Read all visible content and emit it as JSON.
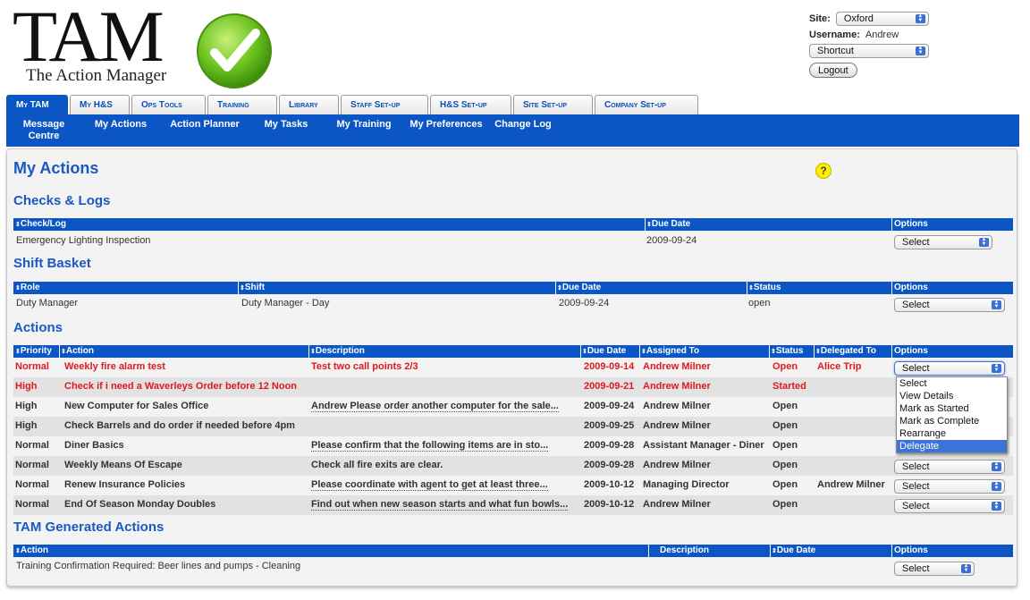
{
  "logo": {
    "title": "TAM",
    "subtitle": "The Action Manager"
  },
  "top_right": {
    "site_label": "Site:",
    "site_value": "Oxford",
    "username_label": "Username:",
    "username_value": "Andrew",
    "shortcut_value": "Shortcut",
    "logout_label": "Logout"
  },
  "tabs": [
    "My TAM",
    "My H&S",
    "Ops Tools",
    "Training",
    "Library",
    "Staff Set-up",
    "H&S Set-up",
    "Site Set-up",
    "Company Set-up"
  ],
  "subnav": [
    "Message Centre",
    "My Actions",
    "Action Planner",
    "My Tasks",
    "My Training",
    "My Preferences",
    "Change Log"
  ],
  "page_title": "My Actions",
  "help_glyph": "?",
  "checks": {
    "title": "Checks & Logs",
    "headers": [
      "Check/Log",
      "Due Date",
      "Options"
    ],
    "rows": [
      {
        "check": "Emergency Lighting Inspection",
        "due": "2009-09-24",
        "option": "Select"
      }
    ]
  },
  "shift": {
    "title": "Shift Basket",
    "headers": [
      "Role",
      "Shift",
      "Due Date",
      "Status",
      "Options"
    ],
    "rows": [
      {
        "role": "Duty Manager",
        "shift": "Duty Manager - Day",
        "due": "2009-09-24",
        "status": "open",
        "option": "Select"
      }
    ]
  },
  "actions": {
    "title": "Actions",
    "headers": [
      "Priority",
      "Action",
      "Description",
      "Due Date",
      "Assigned To",
      "Status",
      "Delegated To",
      "Options"
    ],
    "rows": [
      {
        "priority": "Normal",
        "action": "Weekly fire alarm test",
        "description": "Test two call points 2/3",
        "due": "2009-09-14",
        "assigned": "Andrew Milner",
        "status": "Open",
        "delegated": "Alice Trip",
        "option": "Select"
      },
      {
        "priority": "High",
        "action": "Check if i need a Waverleys Order before 12 Noon",
        "description": "",
        "due": "2009-09-21",
        "assigned": "Andrew Milner",
        "status": "Started",
        "delegated": "",
        "option": ""
      },
      {
        "priority": "High",
        "action": "New Computer for Sales Office",
        "description": "Andrew Please order another computer for the sale...",
        "due": "2009-09-24",
        "assigned": "Andrew Milner",
        "status": "Open",
        "delegated": "",
        "option": ""
      },
      {
        "priority": "High",
        "action": "Check Barrels and do order if needed before 4pm",
        "description": "",
        "due": "2009-09-25",
        "assigned": "Andrew Milner",
        "status": "Open",
        "delegated": "",
        "option": ""
      },
      {
        "priority": "Normal",
        "action": "Diner Basics",
        "description": "Please confirm that the following items are in sto...",
        "due": "2009-09-28",
        "assigned": "Assistant Manager - Diner",
        "status": "Open",
        "delegated": "",
        "option": ""
      },
      {
        "priority": "Normal",
        "action": "Weekly Means Of Escape",
        "description": "Check all fire exits are clear.",
        "due": "2009-09-28",
        "assigned": "Andrew Milner",
        "status": "Open",
        "delegated": "",
        "option": "Select"
      },
      {
        "priority": "Normal",
        "action": "Renew Insurance Policies",
        "description": "Please coordinate with agent to get at least three...",
        "due": "2009-10-12",
        "assigned": "Managing Director",
        "status": "Open",
        "delegated": "Andrew Milner",
        "option": "Select"
      },
      {
        "priority": "Normal",
        "action": "End Of Season Monday Doubles",
        "description": "Find out when new season starts and what fun bowls...",
        "due": "2009-10-12",
        "assigned": "Andrew Milner",
        "status": "Open",
        "delegated": "",
        "option": "Select"
      }
    ],
    "dropdown_options": [
      "Select",
      "View Details",
      "Mark as Started",
      "Mark as Complete",
      "Rearrange",
      "Delegate"
    ],
    "dropdown_highlighted": "Delegate"
  },
  "generated": {
    "title": "TAM Generated Actions",
    "headers": [
      "Action",
      "Description",
      "Due Date",
      "Options"
    ],
    "rows": [
      {
        "action": "Training Confirmation Required: Beer lines and pumps - Cleaning",
        "option": "Select"
      }
    ]
  },
  "colors": {
    "brand_blue": "#0b56c4",
    "title_blue": "#1a58c2",
    "overdue_red": "#e0191d",
    "help_yellow": "#ffee00"
  }
}
